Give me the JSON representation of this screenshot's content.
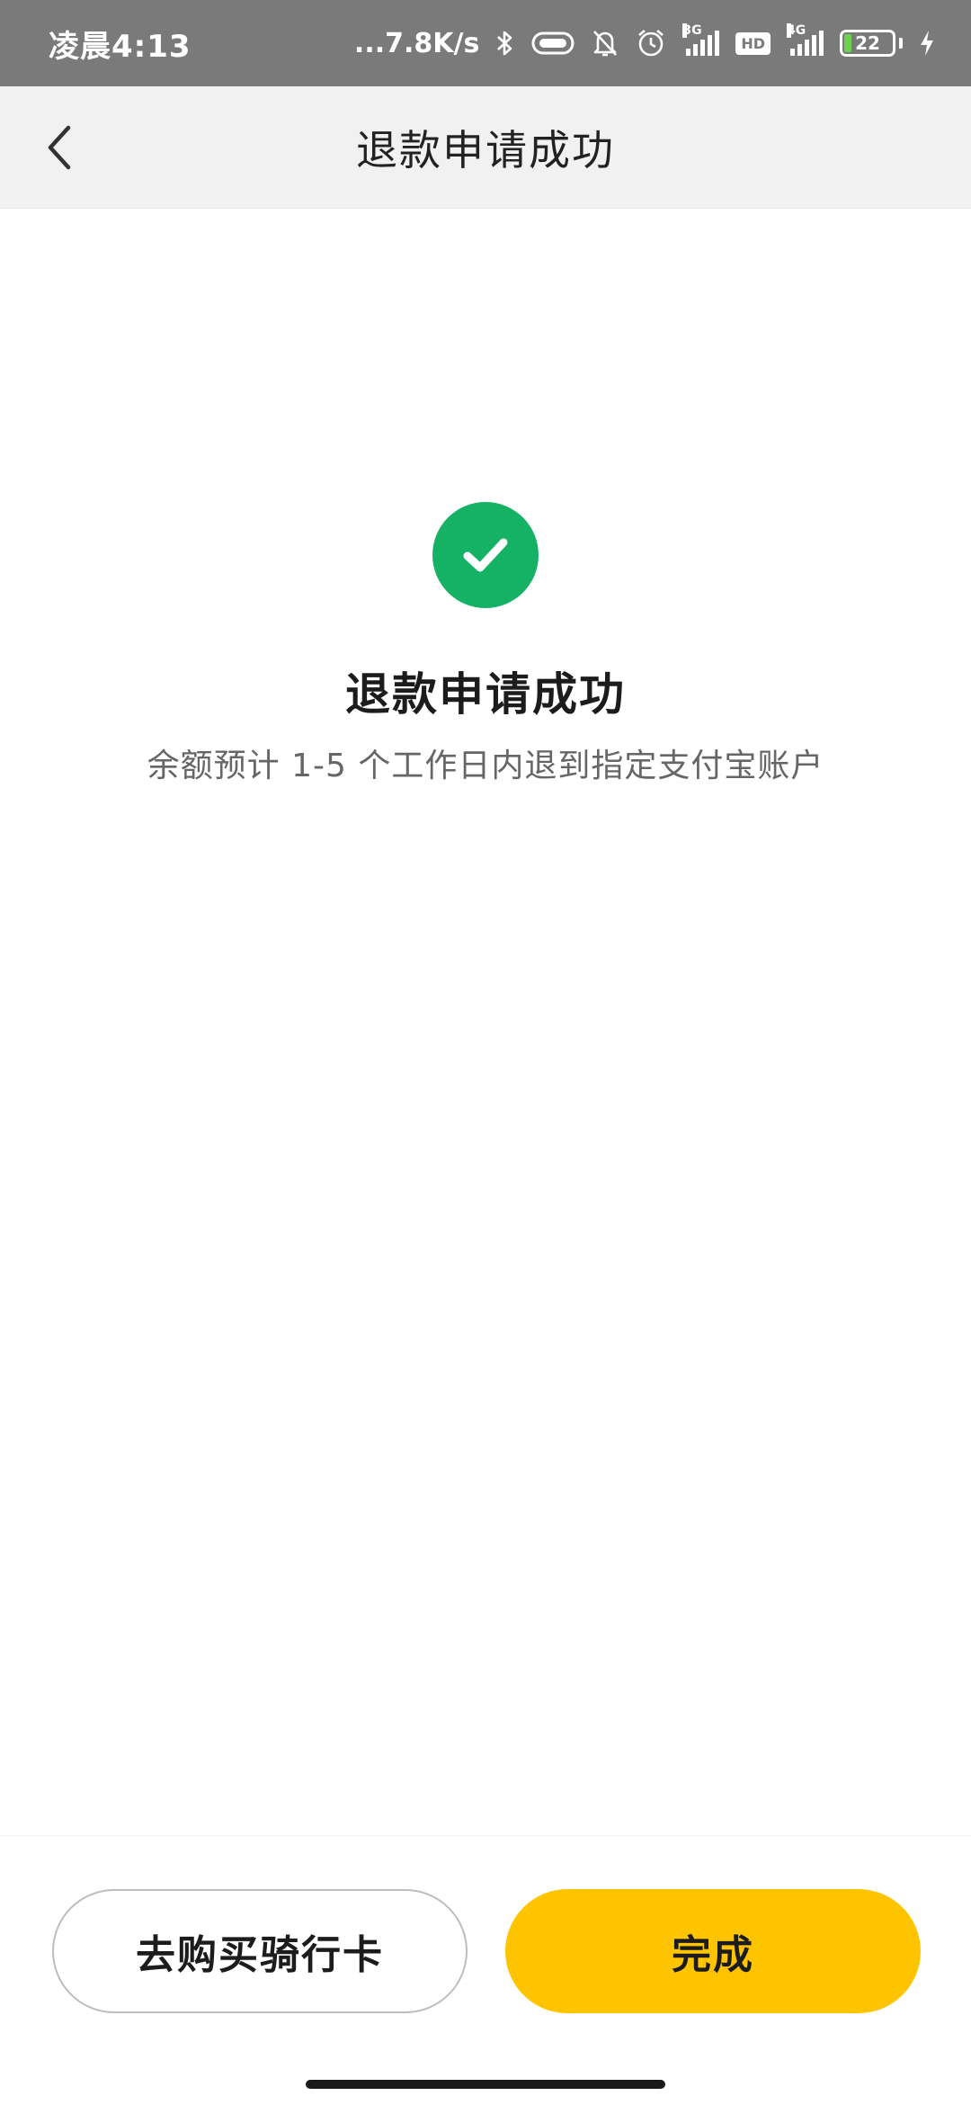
{
  "status_bar": {
    "time": "凌晨4:13",
    "network_speed": "...7.8K/s",
    "signal_1_tag": "3G",
    "hd_label": "HD",
    "signal_2_tag": "4G",
    "battery_level": "22",
    "icons": [
      "bluetooth-icon",
      "vibrate-icon",
      "mute-icon",
      "alarm-icon",
      "signal-icon",
      "hd-icon",
      "battery-icon",
      "charging-icon"
    ]
  },
  "nav": {
    "title": "退款申请成功",
    "back_icon": "chevron-left-icon"
  },
  "result": {
    "icon": "check-circle-icon",
    "icon_color": "#15b266",
    "title": "退款申请成功",
    "description": "余额预计 1-5 个工作日内退到指定支付宝账户"
  },
  "actions": {
    "secondary_label": "去购买骑行卡",
    "primary_label": "完成",
    "primary_color": "#ffc400"
  }
}
